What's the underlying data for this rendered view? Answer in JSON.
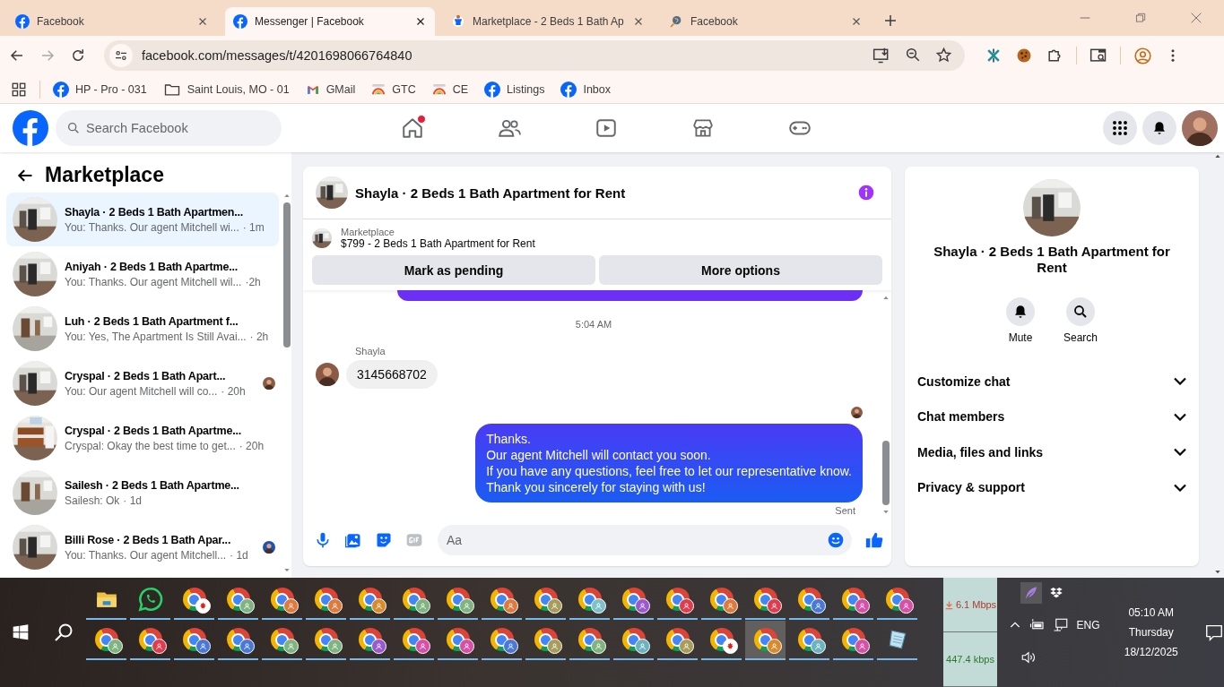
{
  "browser": {
    "tabs": [
      {
        "title": "Facebook",
        "kind": "facebook",
        "selected": false
      },
      {
        "title": "Messenger | Facebook",
        "kind": "facebook",
        "selected": true
      },
      {
        "title": "Marketplace - 2 Beds 1 Bath Ap",
        "kind": "marketplace",
        "selected": false
      },
      {
        "title": "Facebook",
        "kind": "globe",
        "selected": false
      }
    ],
    "url": "facebook.com/messages/t/4201698066764840",
    "bookmarks": [
      {
        "label": "HP - Pro - 031",
        "kind": "facebook"
      },
      {
        "label": "Saint Louis, MO - 01",
        "kind": "folder"
      },
      {
        "label": "GMail",
        "kind": "gmail"
      },
      {
        "label": "GTC",
        "kind": "rainbow"
      },
      {
        "label": "CE",
        "kind": "rainbow"
      },
      {
        "label": "Listings",
        "kind": "facebook"
      },
      {
        "label": "Inbox",
        "kind": "facebook"
      }
    ]
  },
  "facebook": {
    "search": {
      "placeholder": "Search Facebook"
    },
    "nav": [
      {
        "kind": "home",
        "notification": true
      },
      {
        "kind": "friends",
        "notification": false
      },
      {
        "kind": "video",
        "notification": false
      },
      {
        "kind": "marketplace",
        "notification": false
      },
      {
        "kind": "gaming",
        "notification": false
      }
    ]
  },
  "sidebar": {
    "title": "Marketplace",
    "conversations": [
      {
        "title": "Shayla · 2 Beds 1 Bath Apartmen...",
        "preview": "You: Thanks. Our agent Mitchell wi...",
        "time": "· 1m",
        "selected": true,
        "seen": false
      },
      {
        "title": "Aniyah · 2 Beds 1 Bath Apartme...",
        "preview": "You: Thanks. Our agent Mitchell wil...",
        "time": "·2h",
        "selected": false,
        "seen": false
      },
      {
        "title": "Luh · 2 Beds 1 Bath Apartment f...",
        "preview": "You: Yes, The Apartment Is Still Avai...",
        "time": "· 2h",
        "selected": false,
        "seen": false
      },
      {
        "title": "Cryspal · 2 Beds 1 Bath Apart...",
        "preview": "You: Our agent Mitchell will co...",
        "time": "· 20h",
        "selected": false,
        "seen": true
      },
      {
        "title": "Cryspal · 2 Beds 1 Bath Apartme...",
        "preview": "Cryspal: Okay the best time to get...",
        "time": "· 20h",
        "selected": false,
        "seen": false
      },
      {
        "title": "Sailesh · 2 Beds 1 Bath Apartme...",
        "preview": "Sailesh: Ok",
        "time": "· 1d",
        "selected": false,
        "seen": false
      },
      {
        "title": "Billi Rose · 2 Beds 1 Bath Apar...",
        "preview": "You: Thanks. Our agent Mitchell...",
        "time": "· 1d",
        "selected": false,
        "seen": true
      }
    ]
  },
  "chat": {
    "title": "Shayla · 2 Beds 1 Bath Apartment for Rent",
    "listing": {
      "label": "Marketplace",
      "item": "$799 - 2 Beds 1 Bath Apartment for Rent",
      "buttons": [
        "Mark as pending",
        "More options"
      ]
    },
    "messages": [
      {
        "kind": "cut-bubble"
      },
      {
        "kind": "timestamp",
        "text": "5:04 AM"
      },
      {
        "kind": "incoming",
        "sender": "Shayla",
        "text": "3145668702"
      },
      {
        "kind": "seen"
      },
      {
        "kind": "outgoing",
        "text": "Thanks.\nOur agent Mitchell will contact you soon.\nIf you have any questions, feel free to let our representative know.\nThank you sincerely for staying with us!"
      },
      {
        "kind": "status",
        "text": "Sent"
      }
    ],
    "composer": {
      "placeholder": "Aa"
    }
  },
  "details": {
    "name": "Shayla · 2 Beds 1 Bath Apartment for Rent",
    "actions": [
      {
        "kind": "mute",
        "label": "Mute"
      },
      {
        "kind": "search",
        "label": "Search"
      }
    ],
    "sections": [
      {
        "label": "Customize chat",
        "expanded": false
      },
      {
        "label": "Chat members",
        "expanded": false
      },
      {
        "label": "Media, files and links",
        "expanded": false
      },
      {
        "label": "Privacy & support",
        "expanded": false
      }
    ]
  },
  "taskbar": {
    "apps_row_1": [
      {
        "kind": "explorer",
        "selected": false
      },
      {
        "kind": "whatsapp",
        "selected": false
      },
      {
        "kind": "chrome-flag",
        "selected": false
      },
      {
        "kind": "chrome",
        "color": "#7fb37f",
        "selected": false
      },
      {
        "kind": "chrome",
        "color": "#e07a3c",
        "selected": false
      },
      {
        "kind": "chrome",
        "color": "#e07a3c",
        "selected": false
      },
      {
        "kind": "chrome",
        "color": "#d98a2a",
        "selected": false
      },
      {
        "kind": "chrome",
        "color": "#7fb37f",
        "selected": false
      },
      {
        "kind": "chrome",
        "color": "#7fb37f",
        "selected": false
      },
      {
        "kind": "chrome",
        "color": "#e07a3c",
        "selected": false
      },
      {
        "kind": "chrome",
        "color": "#a89c5a",
        "selected": false
      },
      {
        "kind": "chrome",
        "color": "#7fc1c9",
        "selected": false
      },
      {
        "kind": "chrome",
        "color": "#9b59d0",
        "selected": false
      },
      {
        "kind": "chrome",
        "color": "#e23b4e",
        "selected": false
      },
      {
        "kind": "chrome",
        "color": "#e07a3c",
        "selected": false
      },
      {
        "kind": "chrome",
        "color": "#e23b4e",
        "selected": false
      },
      {
        "kind": "chrome",
        "color": "#4a78d6",
        "selected": false
      },
      {
        "kind": "chrome",
        "color": "#d84fa6",
        "selected": false
      },
      {
        "kind": "chrome",
        "color": "#d84fa6",
        "selected": false
      }
    ],
    "apps_row_2": [
      {
        "kind": "chrome",
        "color": "#7fb37f",
        "selected": false
      },
      {
        "kind": "chrome",
        "color": "#e23b4e",
        "selected": false
      },
      {
        "kind": "chrome",
        "color": "#4a78d6",
        "selected": false
      },
      {
        "kind": "chrome",
        "color": "#4a78d6",
        "selected": false
      },
      {
        "kind": "chrome",
        "color": "#7fb37f",
        "selected": false
      },
      {
        "kind": "chrome",
        "color": "#7fb37f",
        "selected": false
      },
      {
        "kind": "chrome",
        "color": "#9b59d0",
        "selected": false
      },
      {
        "kind": "chrome",
        "color": "#d84fa6",
        "selected": false
      },
      {
        "kind": "chrome",
        "color": "#d84fa6",
        "selected": false
      },
      {
        "kind": "chrome",
        "color": "#4a78d6",
        "selected": false
      },
      {
        "kind": "chrome",
        "color": "#a89c5a",
        "selected": false
      },
      {
        "kind": "chrome",
        "color": "#7fb37f",
        "selected": false
      },
      {
        "kind": "chrome",
        "color": "#6cb3bf",
        "selected": false
      },
      {
        "kind": "chrome",
        "color": "#a89c5a",
        "selected": false
      },
      {
        "kind": "chrome-flag",
        "selected": false
      },
      {
        "kind": "chrome",
        "color": "#d98a2a",
        "selected": true
      },
      {
        "kind": "chrome",
        "color": "#6cb3bf",
        "selected": false
      },
      {
        "kind": "chrome",
        "color": "#d84fa6",
        "selected": false
      },
      {
        "kind": "notepad",
        "selected": false
      }
    ],
    "download_speed": "6.1 Mbps",
    "upload_speed": "447.4 kbps",
    "language": "ENG",
    "clock": {
      "time": "05:10 AM",
      "day": "Thursday",
      "date": "18/12/2025"
    }
  }
}
